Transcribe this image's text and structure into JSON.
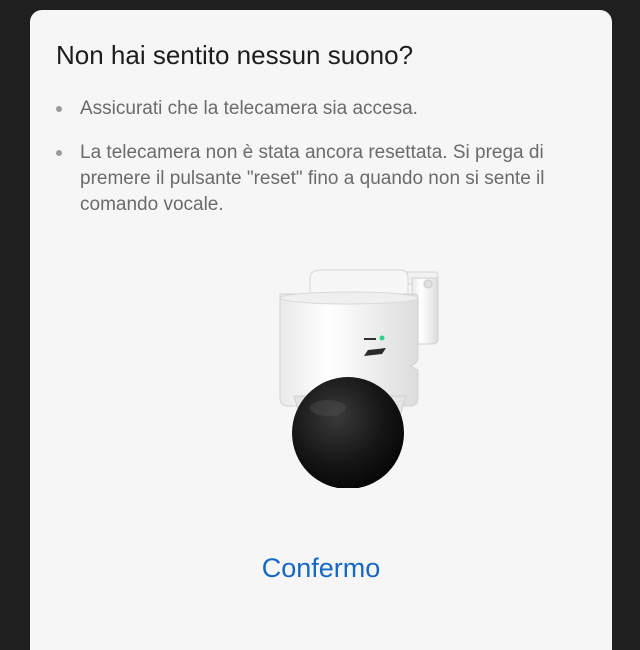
{
  "dialog": {
    "title": "Non hai sentito nessun suono?",
    "tips": [
      "Assicurati che la telecamera sia accesa.",
      "La telecamera non è stata ancora resettata. Si prega di premere il pulsante \"reset\" fino a quando non si sente il comando vocale."
    ],
    "image_icon": "security-camera-illustration",
    "confirm_label": "Confermo"
  },
  "colors": {
    "dialog_background": "#f6f6f6",
    "backdrop": "#1f1f1f",
    "accent": "#1667c6",
    "title_text": "#1d1d1d",
    "body_text": "#6b6b6b"
  }
}
